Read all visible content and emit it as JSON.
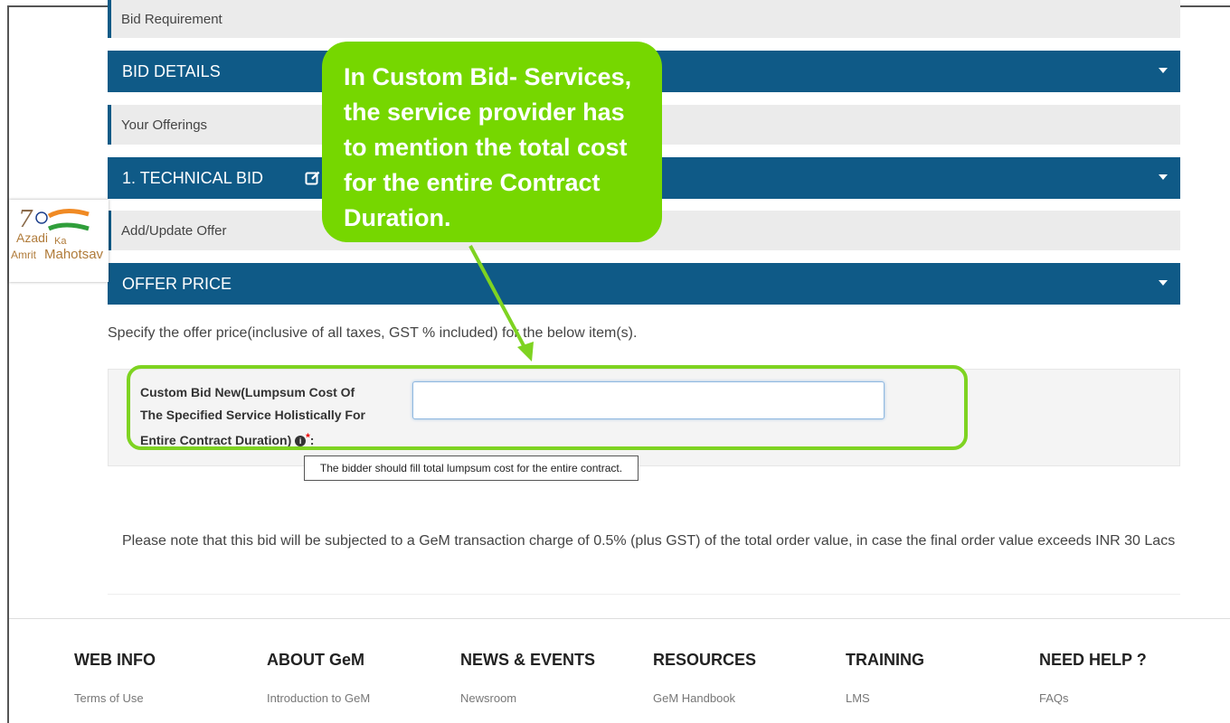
{
  "sections": {
    "bid_requirement": "Bid Requirement",
    "bid_details": "BID DETAILS",
    "your_offerings": "Your Offerings",
    "technical_bid": "1. TECHNICAL BID",
    "add_update_offer": "Add/Update Offer",
    "offer_price": "OFFER PRICE"
  },
  "logo": {
    "line1": "Azadi",
    "ka": "Ka",
    "amrit": "Amrit",
    "mahotsav": "Mahotsav"
  },
  "offer_price": {
    "instruction": "Specify the offer price(inclusive of all taxes, GST % included) for the below item(s).",
    "field_label": "Custom Bid New(Lumpsum Cost Of The Specified Service Holistically For Entire Contract Duration)",
    "required_mark": "*",
    "colon": ":",
    "input_value": "",
    "tooltip": "The bidder should fill total lumpsum cost for the entire contract."
  },
  "note": "Please note that this bid will be subjected to a GeM transaction charge of 0.5% (plus GST) of the total order value, in case the final order value exceeds INR 30 Lacs",
  "callout": "In Custom Bid- Services, the service provider has to mention the total cost for the entire Contract Duration.",
  "footer": [
    {
      "head": "WEB INFO",
      "link": "Terms of Use"
    },
    {
      "head": "ABOUT GeM",
      "link": "Introduction to GeM"
    },
    {
      "head": "NEWS & EVENTS",
      "link": "Newsroom"
    },
    {
      "head": "RESOURCES",
      "link": "GeM Handbook"
    },
    {
      "head": "TRAINING",
      "link": "LMS"
    },
    {
      "head": "NEED HELP ?",
      "link": "FAQs"
    }
  ],
  "colors": {
    "section_blue": "#0f5a87",
    "callout_green": "#76d700",
    "outline_green": "#7ed321"
  }
}
